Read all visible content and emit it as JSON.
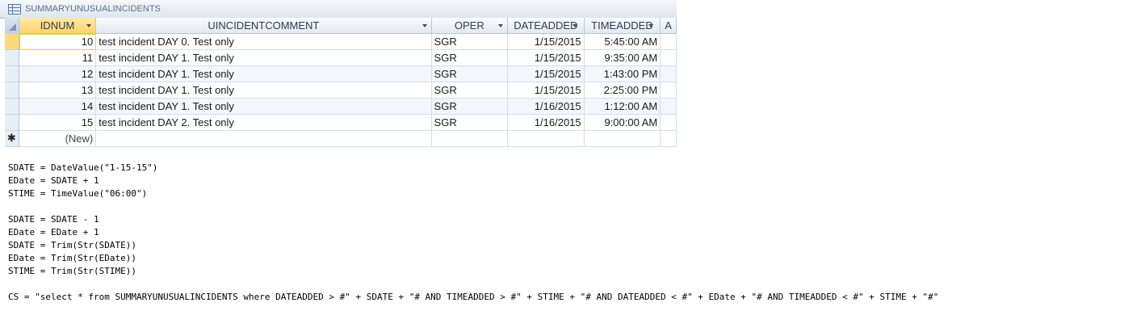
{
  "window": {
    "title": "SUMMARYUNUSUALINCIDENTS",
    "icon": "table-icon"
  },
  "columns": [
    {
      "key": "idnum",
      "label": "IDNUM",
      "dropdown": true
    },
    {
      "key": "comment",
      "label": "UINCIDENTCOMMENT",
      "dropdown": true
    },
    {
      "key": "oper",
      "label": "OPER",
      "dropdown": true
    },
    {
      "key": "dateadded",
      "label": "DATEADDED",
      "dropdown": true
    },
    {
      "key": "timeadded",
      "label": "TIMEADDED",
      "dropdown": true
    },
    {
      "key": "extra",
      "label": "A",
      "dropdown": false
    }
  ],
  "rows": [
    {
      "idnum": "10",
      "comment": "test incident DAY 0. Test only",
      "oper": "SGR",
      "dateadded": "1/15/2015",
      "timeadded": "5:45:00 AM"
    },
    {
      "idnum": "11",
      "comment": "test incident DAY 1. Test only",
      "oper": "SGR",
      "dateadded": "1/15/2015",
      "timeadded": "9:35:00 AM"
    },
    {
      "idnum": "12",
      "comment": "test incident DAY 1. Test only",
      "oper": "SGR",
      "dateadded": "1/15/2015",
      "timeadded": "1:43:00 PM"
    },
    {
      "idnum": "13",
      "comment": "test incident DAY 1. Test only",
      "oper": "SGR",
      "dateadded": "1/15/2015",
      "timeadded": "2:25:00 PM"
    },
    {
      "idnum": "14",
      "comment": "test incident DAY 1. Test only",
      "oper": "SGR",
      "dateadded": "1/16/2015",
      "timeadded": "1:12:00 AM"
    },
    {
      "idnum": "15",
      "comment": "test incident DAY 2. Test only",
      "oper": "SGR",
      "dateadded": "1/16/2015",
      "timeadded": "9:00:00 AM"
    }
  ],
  "new_row": {
    "marker": "✱",
    "label": "(New)"
  },
  "code_lines": [
    "SDATE = DateValue(\"1-15-15\")",
    "EDate = SDATE + 1",
    "STIME = TimeValue(\"06:00\")",
    "",
    "SDATE = SDATE - 1",
    "EDate = EDate + 1",
    "SDATE = Trim(Str(SDATE))",
    "EDate = Trim(Str(EDate))",
    "STIME = Trim(Str(STIME))",
    "",
    "CS = \"select * from SUMMARYUNUSUALINCIDENTS where DATEADDED > #\" + SDATE + \"# AND TIMEADDED > #\" + STIME + \"# AND DATEADDED < #\" + EDate + \"# AND TIMEADDED < #\" + STIME + \"#\""
  ],
  "colors": {
    "selected_header": "#ffd26a",
    "grid_line": "#d5dce6",
    "header_bg": "#e3e9f1"
  }
}
